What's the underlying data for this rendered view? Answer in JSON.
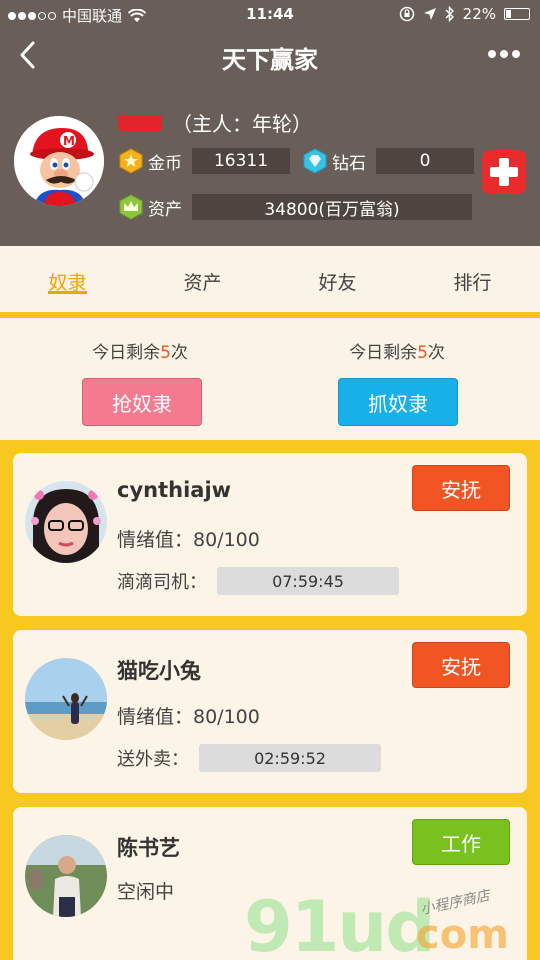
{
  "status": {
    "carrier": "中国联通",
    "time": "11:44",
    "battery": "22%"
  },
  "nav": {
    "title": "天下赢家"
  },
  "profile": {
    "owner_label": "（主人：年轮）",
    "coins_label": "金币",
    "coins": "16311",
    "diamond_label": "钻石",
    "diamonds": "0",
    "assets_label": "资产",
    "assets": "34800(百万富翁)"
  },
  "tabs": [
    {
      "label": "奴隶"
    },
    {
      "label": "资产"
    },
    {
      "label": "好友"
    },
    {
      "label": "排行"
    }
  ],
  "actions": {
    "left_remain_prefix": "今日剩余",
    "left_remain_num": "5",
    "left_remain_suffix": "次",
    "right_remain_prefix": "今日剩余",
    "right_remain_num": "5",
    "right_remain_suffix": "次",
    "grab_label": "抢奴隶",
    "catch_label": "抓奴隶"
  },
  "slaves": [
    {
      "name": "cynthiajw",
      "mood": "情绪值：80/100",
      "job": "滴滴司机：",
      "timer": "07:59:45",
      "action": "安抚"
    },
    {
      "name": "猫吃小兔",
      "mood": "情绪值：80/100",
      "job": "送外卖：",
      "timer": "02:59:52",
      "action": "安抚"
    },
    {
      "name": "陈书艺",
      "state": "空闲中",
      "action": "工作"
    }
  ],
  "watermark": {
    "text": "91ud",
    "com": "com",
    "tag": "小程序商店"
  }
}
